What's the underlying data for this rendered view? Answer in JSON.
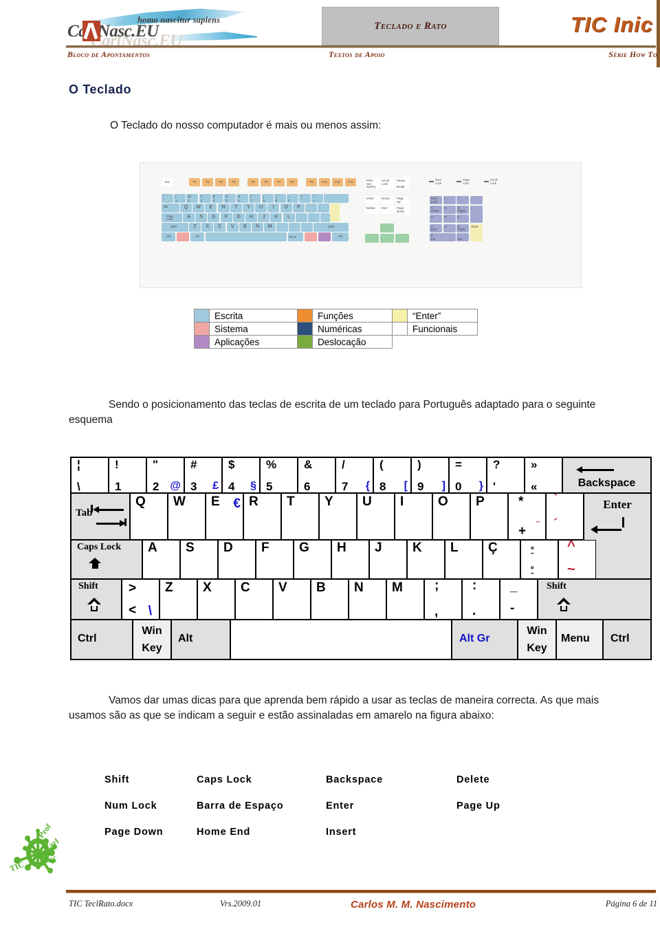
{
  "header": {
    "logo_tagline": "homo nascitur sapiens",
    "logo_text": "CarlNasc.EU",
    "logo_ghost": "CarlNasc.EU",
    "title": "Teclado e Rato",
    "brand": "TIC Inic",
    "sub_left": "Bloco de Apontamentos",
    "sub_mid": "Textos de Apoio",
    "sub_right": "Série How To"
  },
  "section": {
    "heading": "O Teclado",
    "para1": "O Teclado do nosso computador é mais ou menos assim:",
    "para2": "Sendo o posicionamento das teclas de escrita de um teclado para Português adaptado para o seguinte esquema",
    "para3": "Vamos dar umas dicas para que aprenda bem rápido a usar as teclas de maneira correcta. As que mais usamos são as que se indicam a seguir e estão assinaladas em amarelo na figura abaixo:"
  },
  "legend": {
    "rows": [
      {
        "c1_label": "Escrita",
        "c1_color": "#9fc9dd",
        "c2_label": "Funções",
        "c2_color": "#ef8d33",
        "c3_label": "“Enter”",
        "c3_color": "#f6f0a8"
      },
      {
        "c1_label": "Sistema",
        "c1_color": "#f0a8a4",
        "c2_label": "Numéricas",
        "c2_color": "#2c4f7c",
        "c3_label": "Funcionais",
        "c3_color": "#ffffff"
      },
      {
        "c1_label": "Aplicações",
        "c1_color": "#b389c4",
        "c2_label": "Deslocação",
        "c2_color": "#7bab3e",
        "c3_label": "",
        "c3_color": ""
      }
    ]
  },
  "keyboard_photo": {
    "function_keys": [
      "F1",
      "F2",
      "F3",
      "F4",
      "F5",
      "F6",
      "F7",
      "F8",
      "F9",
      "F10",
      "F11",
      "F12"
    ],
    "esc": "Esc",
    "number_row": [
      {
        "top": "\"",
        "bottom": "'"
      },
      {
        "top": "!",
        "bottom": "1"
      },
      {
        "top": "@",
        "bottom": "2"
      },
      {
        "top": "#",
        "bottom": "3"
      },
      {
        "top": "$",
        "bottom": "4"
      },
      {
        "top": "%",
        "bottom": "5"
      },
      {
        "top": "&",
        "bottom": "6"
      },
      {
        "top": "/",
        "bottom": "7"
      },
      {
        "top": "(",
        "bottom": "8"
      },
      {
        "top": ")",
        "bottom": "9"
      },
      {
        "top": "=",
        "bottom": "0"
      },
      {
        "top": "?",
        "bottom": "'"
      },
      {
        "top": "»",
        "bottom": "«"
      }
    ],
    "row_q": [
      "Q",
      "W",
      "E",
      "R",
      "T",
      "Y",
      "U",
      "I",
      "O",
      "P"
    ],
    "row_a": [
      "A",
      "S",
      "D",
      "F",
      "G",
      "H",
      "J",
      "K",
      "L"
    ],
    "row_z": [
      "Z",
      "X",
      "C",
      "V",
      "B",
      "N",
      "M"
    ],
    "modifiers": {
      "tab": "Tab",
      "caps": "Caps Lock",
      "shift": "Shift",
      "ctrl": "Ctrl",
      "alt": "Alt",
      "altgr": "Alt Gr"
    },
    "nav_cluster": [
      "Print Scrn SysRq",
      "Scroll Lock",
      "Pause Break",
      "Insert",
      "Home",
      "Page Up",
      "Delete",
      "End",
      "Page Down"
    ],
    "leds": [
      "Num Lock",
      "Caps Lock",
      "Scroll Lock"
    ],
    "numpad": [
      "Num Lock",
      "/",
      "*",
      "-",
      "7 Home",
      "8",
      "9 PgUp",
      "+",
      "4",
      "5",
      "6",
      "1 End",
      "2",
      "3 PgDn",
      "Enter",
      "0 Ins",
      "Del"
    ]
  },
  "pt_keyboard": {
    "row1": [
      {
        "top": "¦",
        "bottom": "\\",
        "alt": ""
      },
      {
        "top": "!",
        "bottom": "1",
        "alt": ""
      },
      {
        "top": "\"",
        "bottom": "2",
        "alt": "@"
      },
      {
        "top": "#",
        "bottom": "3",
        "alt": "£"
      },
      {
        "top": "$",
        "bottom": "4",
        "alt": "§"
      },
      {
        "top": "%",
        "bottom": "5",
        "alt": ""
      },
      {
        "top": "&",
        "bottom": "6",
        "alt": ""
      },
      {
        "top": "/",
        "bottom": "7",
        "alt": "{"
      },
      {
        "top": "(",
        "bottom": "8",
        "alt": "["
      },
      {
        "top": ")",
        "bottom": "9",
        "alt": "]"
      },
      {
        "top": "=",
        "bottom": "0",
        "alt": "}"
      },
      {
        "top": "?",
        "bottom": "'",
        "alt": ""
      },
      {
        "top": "»",
        "bottom": "«",
        "alt": ""
      }
    ],
    "backspace": "Backspace",
    "tab": "Tab",
    "row2": [
      "Q",
      "W",
      "E",
      "R",
      "T",
      "Y",
      "U",
      "I",
      "O",
      "P"
    ],
    "row2_euro": "€",
    "row2_plus": {
      "top": "*",
      "bottom": "+",
      "alt": "¨"
    },
    "row2_accent": {
      "top": "`",
      "bottom": "´"
    },
    "enter": "Enter",
    "caps_lock": "Caps Lock",
    "row3": [
      "A",
      "S",
      "D",
      "F",
      "G",
      "H",
      "J",
      "K",
      "L",
      "Ç"
    ],
    "row3_ord": {
      "top": "ª",
      "bottom": "º"
    },
    "row3_til": {
      "top": "^",
      "bottom": "~"
    },
    "shift_left": "Shift",
    "shift_right": "Shift",
    "row4_lt": {
      "top": ">",
      "bottom": "<",
      "alt": "\\"
    },
    "row4": [
      "Z",
      "X",
      "C",
      "V",
      "B",
      "N",
      "M"
    ],
    "row4_semi": {
      "top": ";",
      "bottom": ","
    },
    "row4_colon": {
      "top": ":",
      "bottom": "."
    },
    "row4_dash": {
      "top": "_",
      "bottom": "-"
    },
    "ctrl_left": "Ctrl",
    "win_left": "Win Key",
    "alt": "Alt",
    "alt_gr": "Alt Gr",
    "win_right": "Win Key",
    "menu": "Menu",
    "ctrl_right": "Ctrl"
  },
  "key_list": [
    [
      "Shift",
      "Caps Lock",
      "Backspace",
      "Delete"
    ],
    [
      "Num Lock",
      "Barra de Espaço",
      "Enter",
      "Page Up"
    ],
    [
      "Page Down",
      "Home End",
      "Insert",
      ""
    ]
  ],
  "bottom_logo": {
    "t1": "Prof",
    "t2": "Carl",
    "t3": "Nasc",
    "t4": "TIC"
  },
  "footer": {
    "file": "TIC TeclRato.docx",
    "version": "Vrs.2009.01",
    "author": "Carlos M. M. Nascimento",
    "page": "Página 6 de 11"
  }
}
